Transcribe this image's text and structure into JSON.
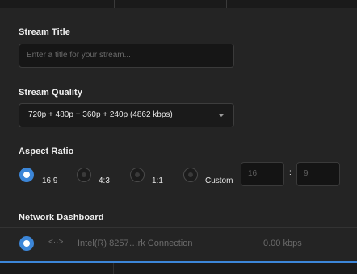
{
  "stream_title": {
    "label": "Stream Title",
    "placeholder": "Enter a title for your stream..."
  },
  "stream_quality": {
    "label": "Stream Quality",
    "selected": "720p + 480p + 360p + 240p (4862 kbps)"
  },
  "aspect_ratio": {
    "label": "Aspect Ratio",
    "options": [
      {
        "label": "16:9",
        "selected": true
      },
      {
        "label": "4:3",
        "selected": false
      },
      {
        "label": "1:1",
        "selected": false
      },
      {
        "label": "Custom",
        "selected": false
      }
    ],
    "custom_width": "16",
    "custom_height": "9",
    "separator": ":"
  },
  "network_dashboard": {
    "label": "Network Dashboard",
    "connection": {
      "icon": "network-arrows-icon",
      "icon_glyph": "<··>",
      "name": "Intel(R) 8257…rk Connection",
      "rate": "0.00 kbps",
      "selected": true
    }
  },
  "colors": {
    "accent": "#3c86d8",
    "background": "#242424",
    "text": "#e6e6e6",
    "muted_text": "#6b6b6b"
  }
}
